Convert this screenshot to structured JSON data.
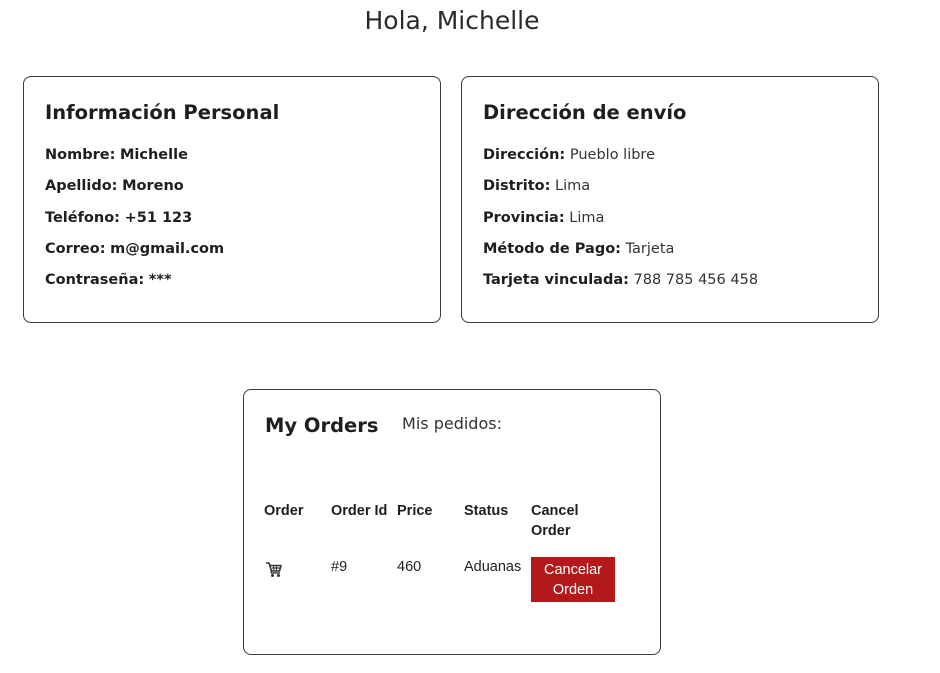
{
  "greeting": "Hola, Michelle",
  "personal": {
    "title": "Información Personal",
    "fields": [
      {
        "label": "Nombre:",
        "value": "Michelle"
      },
      {
        "label": "Apellido:",
        "value": "Moreno"
      },
      {
        "label": "Teléfono:",
        "value": "+51 123"
      },
      {
        "label": "Correo:",
        "value": "m@gmail.com"
      },
      {
        "label": "Contraseña:",
        "value": "***"
      }
    ]
  },
  "shipping": {
    "title": "Dirección de envío",
    "fields": [
      {
        "label": "Dirección:",
        "value": "Pueblo libre"
      },
      {
        "label": "Distrito:",
        "value": "Lima"
      },
      {
        "label": "Provincia:",
        "value": "Lima"
      },
      {
        "label": "Método de Pago:",
        "value": "Tarjeta"
      },
      {
        "label": "Tarjeta vinculada:",
        "value": "788 785 456 458"
      }
    ]
  },
  "orders": {
    "caption": "Mis pedidos:",
    "title": "My Orders",
    "columns": [
      "Order",
      "Order Id",
      "Price",
      "Status",
      "Cancel Order"
    ],
    "rows": [
      {
        "icon": "shopping-cart-icon",
        "id": "#9",
        "price": "460",
        "status": "Aduanas",
        "action_label": "Cancelar Orden"
      }
    ]
  },
  "colors": {
    "accent": "#a8201a",
    "button": "#b3191b",
    "border": "#3a3a3a"
  }
}
